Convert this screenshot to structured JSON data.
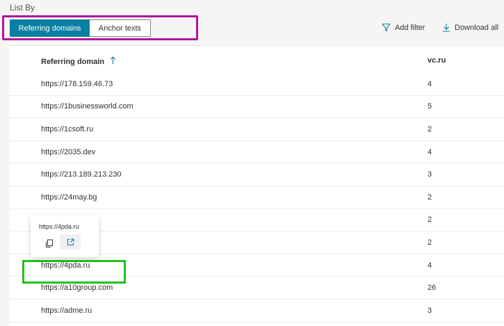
{
  "list_by_label": "List By",
  "tabs": [
    {
      "label": "Referring domains",
      "active": true
    },
    {
      "label": "Anchor texts",
      "active": false
    }
  ],
  "toolbar": {
    "add_filter_label": "Add filter",
    "download_all_label": "Download all"
  },
  "table": {
    "columns": {
      "domain": "Referring domain",
      "count": "vc.ru",
      "sort": "ascending"
    },
    "rows": [
      {
        "domain": "https://178.159.46.73",
        "count": "4"
      },
      {
        "domain": "https://1businessworld.com",
        "count": "5"
      },
      {
        "domain": "https://1csoft.ru",
        "count": "2"
      },
      {
        "domain": "https://2035.dev",
        "count": "4"
      },
      {
        "domain": "https://213.189.213.230",
        "count": "3"
      },
      {
        "domain": "https://24may.bg",
        "count": "2"
      },
      {
        "domain": "",
        "count": "2"
      },
      {
        "domain": "om",
        "count": "2"
      },
      {
        "domain": "https://4pda.ru",
        "count": "4"
      },
      {
        "domain": "https://a10group.com",
        "count": "26"
      },
      {
        "domain": "https://adme.ru",
        "count": "3"
      }
    ]
  },
  "tooltip": {
    "url": "https://4pda.ru",
    "copy_icon": "copy-icon",
    "open_icon": "open-external-icon"
  },
  "colors": {
    "accent": "#0a7fa2",
    "tab_highlight": "#b4139e",
    "row_highlight": "#1ec21e"
  }
}
